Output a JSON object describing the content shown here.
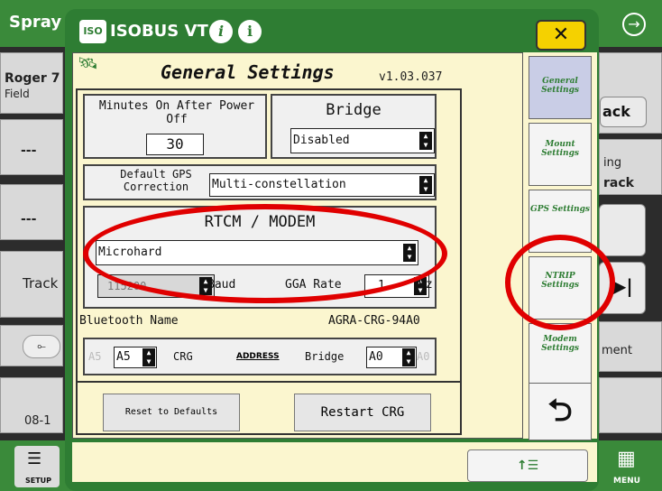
{
  "background": {
    "app_title": "Spray",
    "operator": "Roger 7",
    "field": "Field",
    "left_values": [
      "---",
      "---"
    ],
    "left_track": "Track",
    "left_date": "08-1",
    "right_labels": [
      "ack",
      "ing",
      "rack",
      "ment"
    ],
    "setup_label": "SETUP",
    "menu_label": "MENU"
  },
  "dialog": {
    "title": "ISOBUS VT",
    "close_symbol": "✕",
    "page_title": "General Settings",
    "version": "v1.03.037"
  },
  "settings": {
    "minutes_label": "Minutes On After Power Off",
    "minutes_value": "30",
    "bridge_label": "Bridge",
    "bridge_value": "Disabled",
    "gps_label": "Default GPS Correction",
    "gps_value": "Multi-constellation",
    "rtcm_title": "RTCM / MODEM",
    "modem_value": "Microhard",
    "baud_value": "115200",
    "baud_label": "Baud",
    "gga_label": "GGA Rate",
    "gga_value": "1",
    "hz_label": "Hz",
    "bluetooth_label": "Bluetooth Name",
    "bluetooth_value": "AGRA-CRG-94A0",
    "addr_left_ghost": "A5",
    "addr_left_value": "A5",
    "crg_label": "CRG",
    "address_label": "ADDRESS",
    "addr_bridge_label": "Bridge",
    "addr_right_value": "A0",
    "addr_right_ghost": "A0",
    "reset_button": "Reset to Defaults",
    "restart_button": "Restart CRG"
  },
  "side_tabs": [
    {
      "label": "General Settings"
    },
    {
      "label": "Mount Settings"
    },
    {
      "label": "GPS Settings"
    },
    {
      "label": "NTRIP Settings"
    },
    {
      "label": "Modem Settings"
    }
  ],
  "bottom": {
    "sort_symbol": "↑☰"
  },
  "colors": {
    "accent_green": "#2e7d33",
    "panel_yellow": "#fbf6cf",
    "close_yellow": "#f5d100",
    "annotation_red": "#e00000"
  }
}
